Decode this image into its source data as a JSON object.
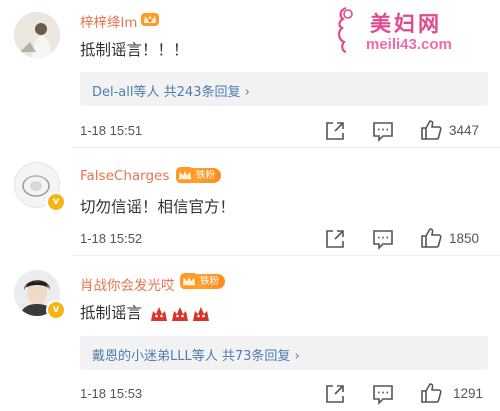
{
  "watermark": {
    "title": "美妇网",
    "url": "meili43.com"
  },
  "comments": [
    {
      "username": "梓梓绛lm",
      "text": "抵制谣言！！！",
      "replies_names": "Del-all等人",
      "replies_count": "共243条回复",
      "replies_arrow": "›",
      "time": "1-18 15:51",
      "likes": "3447"
    },
    {
      "username": "FalseCharges",
      "fan_badge": "铁粉",
      "verified_mark": "v",
      "text": "切勿信谣！相信官方！",
      "time": "1-18 15:52",
      "likes": "1850"
    },
    {
      "username": "肖战你会发光哎",
      "fan_badge": "铁粉",
      "verified_mark": "v",
      "text": "抵制谣言",
      "replies_names": "戴恩的小迷弟LLL等人",
      "replies_count": "共73条回复",
      "replies_arrow": "›",
      "time": "1-18 15:53",
      "likes": "1291"
    }
  ],
  "icons": {
    "share": "share-icon",
    "comment": "comment-icon",
    "like": "like-icon",
    "angry_emoji": "angry-emoji-icon",
    "crown_badge": "crown-badge-icon"
  },
  "colors": {
    "username": "#eb7350",
    "link": "#507daf",
    "watermark": "#e4488e",
    "badge": "#ff9a2a"
  }
}
